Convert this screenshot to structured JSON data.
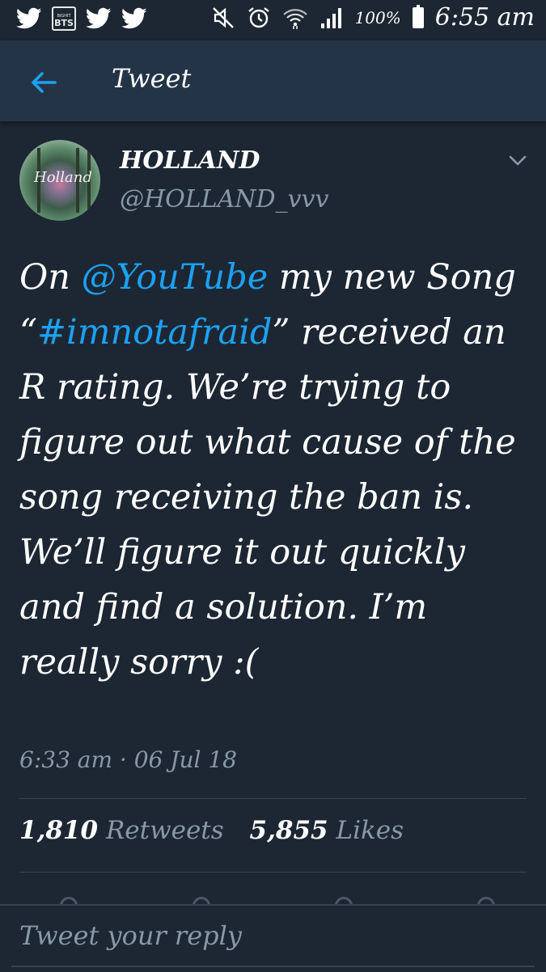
{
  "status_bar": {
    "badge_top": "BIGHIT",
    "badge_label": "BTS",
    "battery_percent": "100%",
    "time": "6:55 am",
    "icons": [
      "twitter-icon",
      "bts-app-icon",
      "twitter-icon",
      "twitter-icon",
      "mute-icon",
      "alarm-icon",
      "wifi-icon",
      "signal-icon",
      "battery-icon"
    ]
  },
  "header": {
    "title": "Tweet",
    "back_icon": "arrow-left-icon"
  },
  "tweet": {
    "author_name": "HOLLAND",
    "author_handle": "@HOLLAND_vvv",
    "avatar_text": "Holland",
    "menu_icon": "chevron-down-icon",
    "text_parts": [
      {
        "text": "On ",
        "link": false
      },
      {
        "text": "@YouTube",
        "link": true
      },
      {
        "text": " my new Song “",
        "link": false
      },
      {
        "text": "#imnotafraid",
        "link": true
      },
      {
        "text": "” received an R rating. We’re trying to figure out what cause of the song receiving the ban is. We’ll figure it out quickly and find a solution. I’m really sorry :(",
        "link": false
      }
    ],
    "timestamp": "6:33 am · 06 Jul 18",
    "retweets_count": "1,810",
    "retweets_label": "Retweets",
    "likes_count": "5,855",
    "likes_label": "Likes"
  },
  "reply": {
    "placeholder": "Tweet your reply"
  },
  "colors": {
    "background": "#1c2733",
    "header": "#243447",
    "accent": "#1da1f2",
    "secondary_text": "#8899a6"
  }
}
